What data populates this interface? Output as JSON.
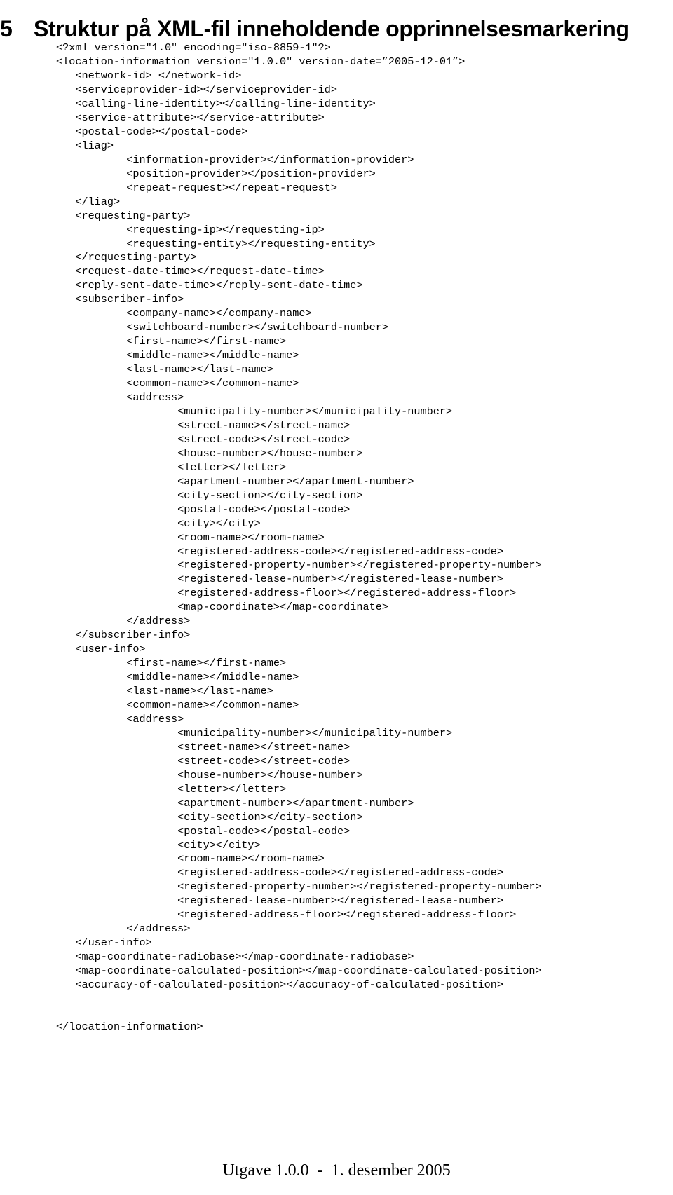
{
  "heading": {
    "number": "5",
    "title": "Struktur på XML-fil inneholdende opprinnelsesmarkering"
  },
  "code": {
    "language": "xml",
    "lines": [
      "<?xml version=\"1.0\" encoding=\"iso-8859-1\"?>",
      "<location-information version=\"1.0.0\" version-date=”2005-12-01”>",
      "   <network-id> </network-id>",
      "   <serviceprovider-id></serviceprovider-id>",
      "   <calling-line-identity></calling-line-identity>",
      "   <service-attribute></service-attribute>",
      "   <postal-code></postal-code>",
      "   <liag>",
      "           <information-provider></information-provider>",
      "           <position-provider></position-provider>",
      "           <repeat-request></repeat-request>",
      "   </liag>",
      "   <requesting-party>",
      "           <requesting-ip></requesting-ip>",
      "           <requesting-entity></requesting-entity>",
      "   </requesting-party>",
      "   <request-date-time></request-date-time>",
      "   <reply-sent-date-time></reply-sent-date-time>",
      "   <subscriber-info>",
      "           <company-name></company-name>",
      "           <switchboard-number></switchboard-number>",
      "           <first-name></first-name>",
      "           <middle-name></middle-name>",
      "           <last-name></last-name>",
      "           <common-name></common-name>",
      "           <address>",
      "                   <municipality-number></municipality-number>",
      "                   <street-name></street-name>",
      "                   <street-code></street-code>",
      "                   <house-number></house-number>",
      "                   <letter></letter>",
      "                   <apartment-number></apartment-number>",
      "                   <city-section></city-section>",
      "                   <postal-code></postal-code>",
      "                   <city></city>",
      "                   <room-name></room-name>",
      "                   <registered-address-code></registered-address-code>",
      "                   <registered-property-number></registered-property-number>",
      "                   <registered-lease-number></registered-lease-number>",
      "                   <registered-address-floor></registered-address-floor>",
      "                   <map-coordinate></map-coordinate>",
      "           </address>",
      "   </subscriber-info>",
      "   <user-info>",
      "           <first-name></first-name>",
      "           <middle-name></middle-name>",
      "           <last-name></last-name>",
      "           <common-name></common-name>",
      "           <address>",
      "                   <municipality-number></municipality-number>",
      "                   <street-name></street-name>",
      "                   <street-code></street-code>",
      "                   <house-number></house-number>",
      "                   <letter></letter>",
      "                   <apartment-number></apartment-number>",
      "                   <city-section></city-section>",
      "                   <postal-code></postal-code>",
      "                   <city></city>",
      "                   <room-name></room-name>",
      "                   <registered-address-code></registered-address-code>",
      "                   <registered-property-number></registered-property-number>",
      "                   <registered-lease-number></registered-lease-number>",
      "                   <registered-address-floor></registered-address-floor>",
      "           </address>",
      "   </user-info>",
      "   <map-coordinate-radiobase></map-coordinate-radiobase>",
      "   <map-coordinate-calculated-position></map-coordinate-calculated-position>",
      "   <accuracy-of-calculated-position></accuracy-of-calculated-position>",
      "",
      "",
      "</location-information>"
    ]
  },
  "footer": {
    "text": "Utgave 1.0.0  -  1. desember 2005"
  },
  "colors": {
    "text": "#000000",
    "background": "#ffffff"
  }
}
